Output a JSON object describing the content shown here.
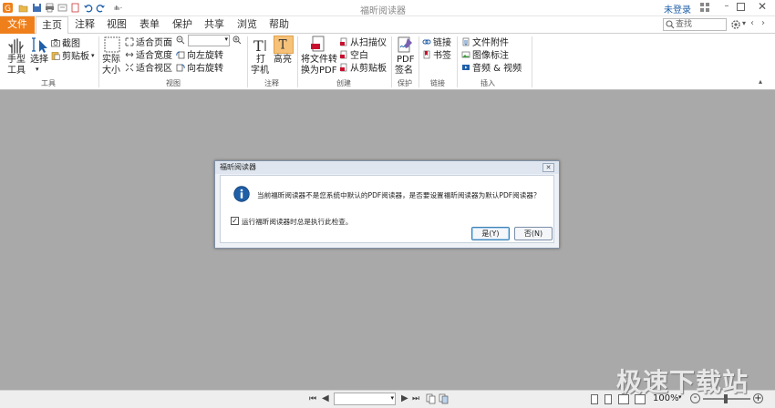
{
  "window": {
    "title": "福昕阅读器",
    "login_label": "未登录",
    "search_placeholder": "查找"
  },
  "tabs": [
    {
      "label": "文件"
    },
    {
      "label": "主页"
    },
    {
      "label": "注释"
    },
    {
      "label": "视图"
    },
    {
      "label": "表单"
    },
    {
      "label": "保护"
    },
    {
      "label": "共享"
    },
    {
      "label": "浏览"
    },
    {
      "label": "帮助"
    }
  ],
  "ribbon": {
    "tools": {
      "hand_line1": "手型",
      "hand_line2": "工具",
      "select_label": "选择",
      "screenshot_label": "截图",
      "clipboard_label": "剪贴板",
      "group_label": "工具"
    },
    "view": {
      "actual_line1": "实际",
      "actual_line2": "大小",
      "fit_page": "适合页面",
      "fit_width": "适合宽度",
      "fit_visible": "适合视区",
      "rotate_left": "向左旋转",
      "rotate_right": "向右旋转",
      "group_label": "视图"
    },
    "comment": {
      "typewriter_line1": "打",
      "typewriter_line2": "字机",
      "highlight_label": "高亮",
      "group_label": "注释"
    },
    "create": {
      "convert_line1": "将文件转",
      "convert_line2": "换为PDF",
      "from_scanner": "从扫描仪",
      "blank": "空白",
      "from_clipboard": "从剪贴板",
      "group_label": "创建"
    },
    "protect": {
      "sign_line1": "PDF",
      "sign_line2": "签名",
      "group_label": "保护"
    },
    "links": {
      "link_label": "链接",
      "bookmark_label": "书签",
      "group_label": "链接"
    },
    "insert": {
      "attachment_label": "文件附件",
      "image_label": "图像标注",
      "media_label": "音频 & 视频",
      "group_label": "插入"
    }
  },
  "dialog": {
    "title": "福昕阅读器",
    "message": "当前福昕阅读器不是您系统中默认的PDF阅读器，是否要设置福昕阅读器为默认PDF阅读器？",
    "checkbox_label": "运行福昕阅读器时总是执行此检查。",
    "checkbox_checked": true,
    "yes_label": "是(Y)",
    "no_label": "否(N)"
  },
  "statusbar": {
    "zoom": "100%"
  },
  "watermark": "极速下载站",
  "colors": {
    "file_tab": "#ef7f1a",
    "workspace": "#a9a9a9",
    "accent_blue": "#1f5fa8"
  }
}
